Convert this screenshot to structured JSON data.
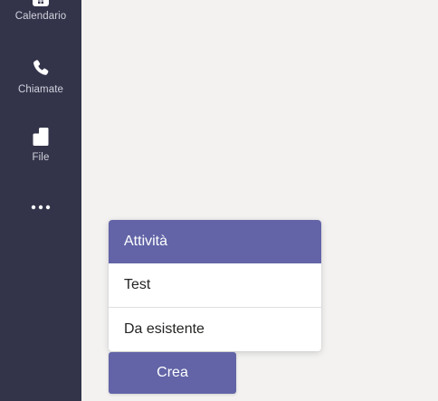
{
  "rail": {
    "items": [
      {
        "label": "Calendario",
        "icon": "calendar-icon"
      },
      {
        "label": "Chiamate",
        "icon": "phone-icon"
      },
      {
        "label": "File",
        "icon": "file-icon"
      },
      {
        "label": "",
        "icon": "more-icon"
      }
    ]
  },
  "menu": {
    "header": "Attività",
    "items": [
      {
        "label": "Test"
      },
      {
        "label": "Da esistente"
      }
    ]
  },
  "actions": {
    "create_label": "Crea"
  },
  "colors": {
    "rail_bg": "#33344a",
    "accent": "#6264a7",
    "main_bg": "#f3f2f1"
  }
}
